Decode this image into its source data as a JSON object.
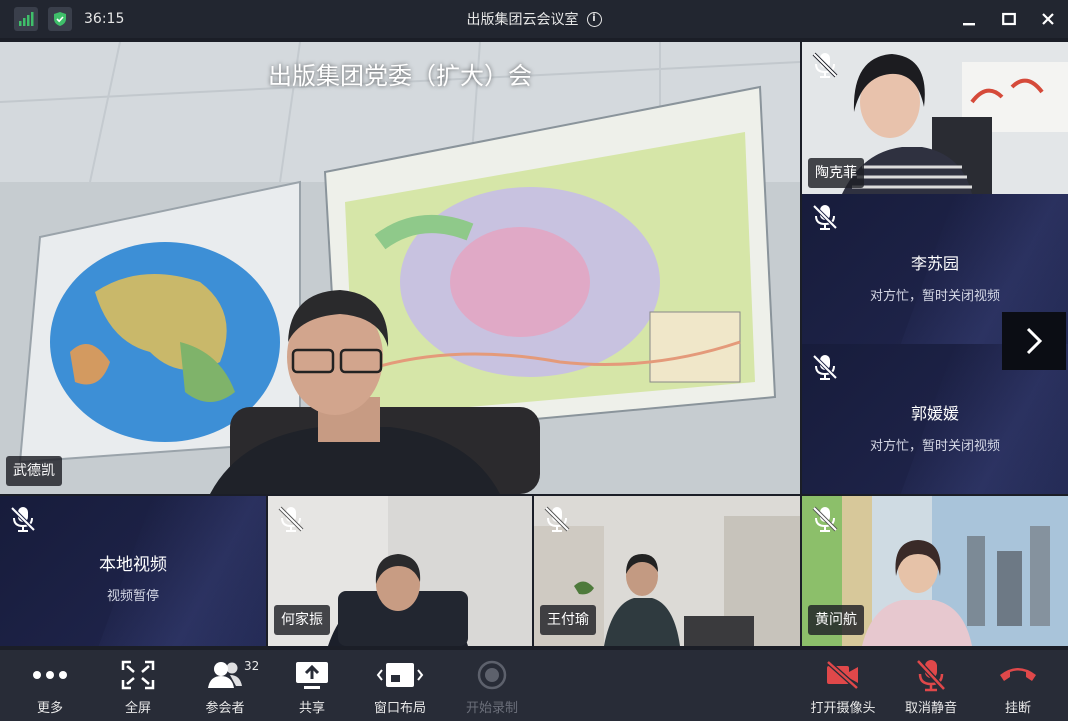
{
  "window": {
    "title": "出版集团云会议室",
    "timer": "36:15"
  },
  "main_video": {
    "caption": "出版集团党委（扩大）会",
    "participant": "武德凯"
  },
  "side_tiles": [
    {
      "name": "陶克菲",
      "video": true
    },
    {
      "name": "李苏园",
      "status": "对方忙，暂时关闭视频",
      "video": false
    },
    {
      "name": "郭媛媛",
      "status": "对方忙，暂时关闭视频",
      "video": false
    }
  ],
  "bottom_tiles": [
    {
      "name": "本地视频",
      "status": "视频暂停",
      "video": false
    },
    {
      "name": "何家振",
      "video": true
    },
    {
      "name": "王付瑜",
      "video": true
    },
    {
      "name": "黄问航",
      "video": true
    }
  ],
  "toolbar": {
    "more": "更多",
    "fullscreen": "全屏",
    "participants": "参会者",
    "participant_count": "32",
    "share": "共享",
    "layout": "窗口布局",
    "record": "开始录制",
    "camera": "打开摄像头",
    "unmute": "取消静音",
    "hangup": "挂断"
  },
  "colors": {
    "accent_red": "#e0484a",
    "secure_green": "#3fbf6a",
    "tile_dark": "#1d2247"
  }
}
